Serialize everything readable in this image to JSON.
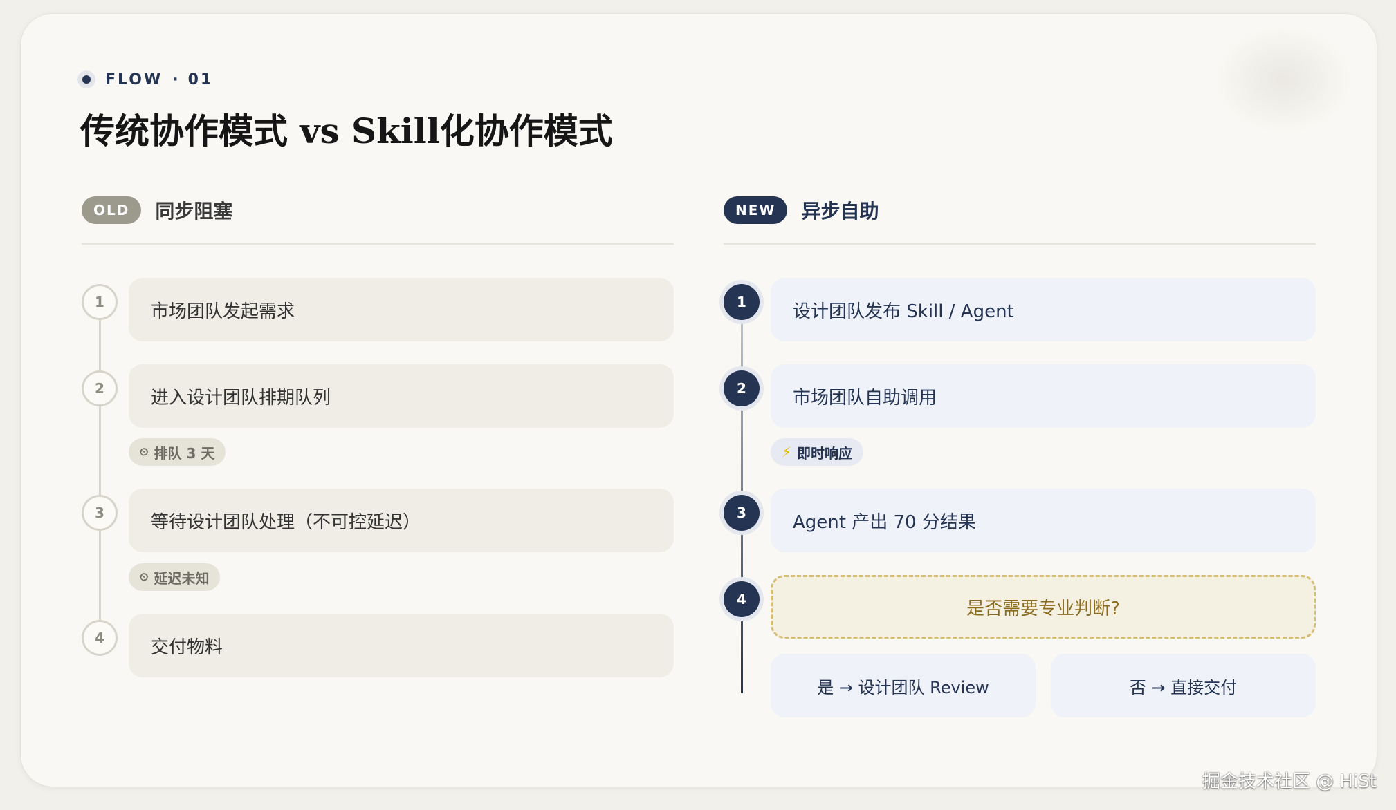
{
  "header": {
    "eyebrow_flow": "FLOW",
    "eyebrow_sep": "·",
    "eyebrow_num": "01",
    "title": "传统协作模式 vs Skill化协作模式"
  },
  "old": {
    "pill": "OLD",
    "label": "同步阻塞",
    "steps": [
      {
        "num": "1",
        "text": "市场团队发起需求"
      },
      {
        "num": "2",
        "text": "进入设计团队排期队列"
      },
      {
        "num": "3",
        "text": "等待设计团队处理（不可控延迟）"
      },
      {
        "num": "4",
        "text": "交付物料"
      }
    ],
    "tags": [
      {
        "icon": "clock-icon",
        "text": "排队 3 天"
      },
      {
        "icon": "clock-icon",
        "text": "延迟未知"
      }
    ]
  },
  "new": {
    "pill": "NEW",
    "label": "异步自助",
    "steps": [
      {
        "num": "1",
        "text": "设计团队发布 Skill / Agent"
      },
      {
        "num": "2",
        "text": "市场团队自助调用"
      },
      {
        "num": "3",
        "text": "Agent 产出 70 分结果"
      },
      {
        "num": "4",
        "text": "是否需要专业判断?"
      }
    ],
    "tag": {
      "icon": "lightning-icon",
      "text": "即时响应"
    },
    "branches": [
      {
        "text": "是 → 设计团队 Review"
      },
      {
        "text": "否 → 直接交付"
      }
    ]
  },
  "watermark": "掘金技术社区 @ HiSt",
  "colors": {
    "navy": "#243452",
    "old_gray": "#9b9a8c",
    "decision_gold": "#d5bd72",
    "card_bg": "#f9f8f4"
  }
}
